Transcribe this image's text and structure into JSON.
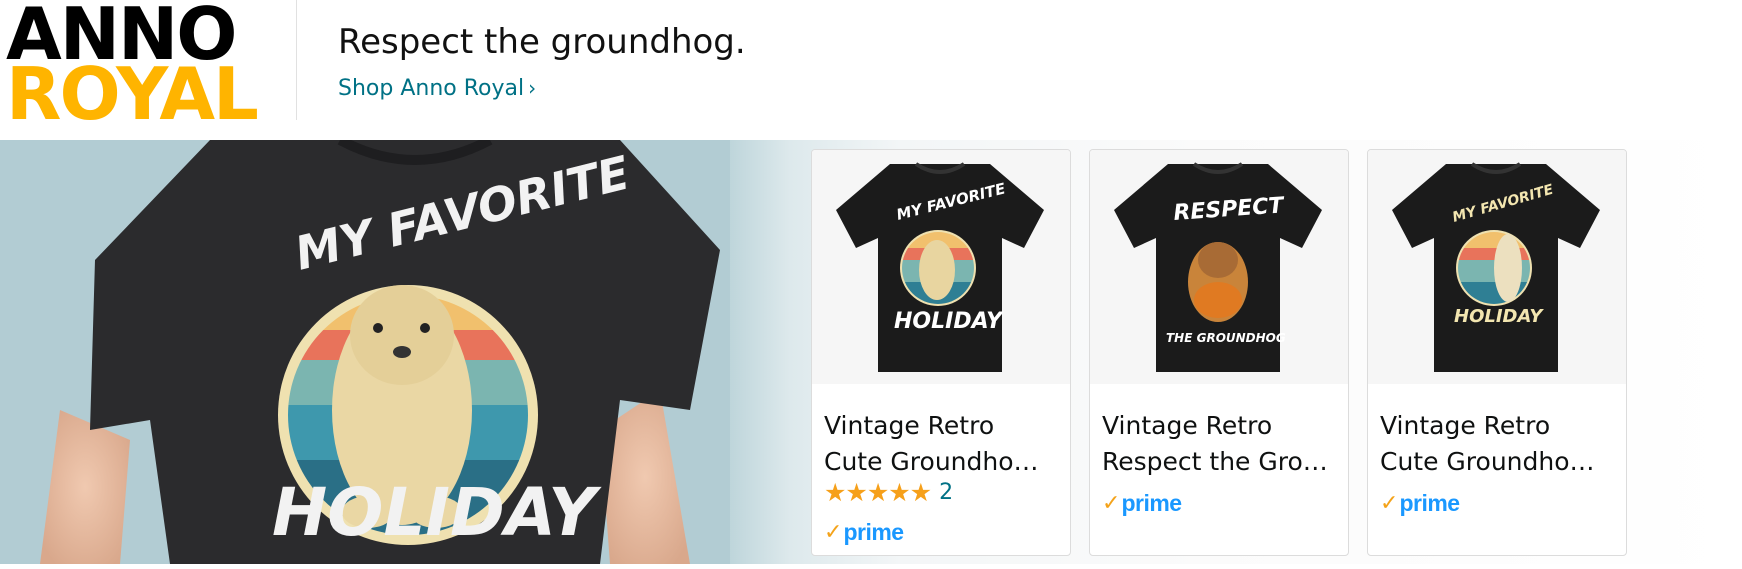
{
  "brand": {
    "logo_line1": "ANNO",
    "logo_line2": "ROYAL",
    "colors": {
      "line1": "#000000",
      "line2": "#ffb400"
    }
  },
  "header": {
    "headline": "Respect the groundhog.",
    "shop_link": "Shop Anno Royal",
    "shop_link_icon": "chevron-right-icon"
  },
  "hero": {
    "shirt_text_top": "MY FAVORITE",
    "shirt_text_bottom": "HOLIDAY"
  },
  "products": [
    {
      "title_line1": "Vintage Retro",
      "title_line2": "Cute Groundho…",
      "art_top": "MY FAVORITE",
      "art_bottom": "HOLIDAY",
      "stars": "★★★★★",
      "rating_count": "2",
      "prime": "prime"
    },
    {
      "title_line1": "Vintage Retro",
      "title_line2": "Respect the Gro…",
      "art_top": "RESPECT",
      "art_bottom": "THE GROUNDHOG",
      "prime": "prime"
    },
    {
      "title_line1": "Vintage Retro",
      "title_line2": "Cute Groundho…",
      "art_top": "MY FAVORITE",
      "art_bottom": "HOLIDAY",
      "prime": "prime"
    }
  ],
  "colors": {
    "link": "#007185",
    "star": "#f6a01a",
    "prime_blue": "#1a98ff",
    "prime_check": "#f4a31a"
  }
}
